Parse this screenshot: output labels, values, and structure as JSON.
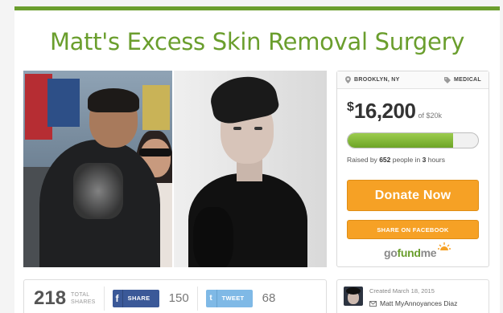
{
  "campaign": {
    "title": "Matt's Excess Skin Removal Surgery"
  },
  "card": {
    "location": "BROOKLYN, NY",
    "category": "MEDICAL",
    "currency": "$",
    "amount_raised": "16,200",
    "goal_text": "of $20k",
    "progress_fraction": 0.81,
    "raised_prefix": "Raised by",
    "people_count": "652",
    "raised_middle": "people in",
    "time_count": "3",
    "time_unit": "hours",
    "donate_label": "Donate Now",
    "share_fb_label": "SHARE ON FACEBOOK",
    "logo_go": "go",
    "logo_fund": "fund",
    "logo_me": "me"
  },
  "share_bar": {
    "total_shares": "218",
    "total_label_1": "TOTAL",
    "total_label_2": "SHARES",
    "fb_icon": "f",
    "fb_label": "SHARE",
    "fb_count": "150",
    "tw_icon": "t",
    "tw_label": "TWEET",
    "tw_count": "68"
  },
  "creator": {
    "created_text": "Created March 18, 2015",
    "name": "Matt MyAnnoyances Diaz"
  },
  "icons": {
    "location": "pin-icon",
    "category": "tag-icon",
    "creator_contact": "mail-icon",
    "logo_decoration": "sun-icon"
  },
  "colors": {
    "brand_green": "#6a9e2d",
    "donate_orange": "#f6a125",
    "facebook_blue": "#3b5998",
    "twitter_blue": "#7fb9e6"
  }
}
